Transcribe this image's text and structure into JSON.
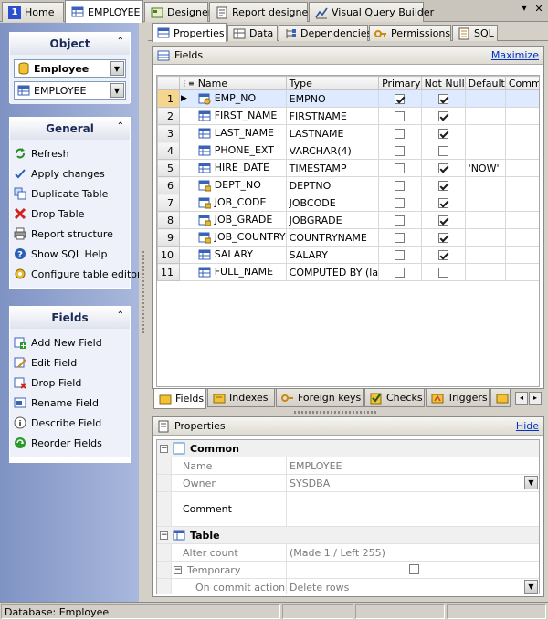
{
  "top_tabs": [
    {
      "label": "Home",
      "icon": "home-1-icon"
    },
    {
      "label": "EMPLOYEE",
      "icon": "table-icon"
    },
    {
      "label": "Designer",
      "icon": "designer-icon"
    },
    {
      "label": "Report designer",
      "icon": "report-icon"
    },
    {
      "label": "Visual Query Builder",
      "icon": "query-icon"
    }
  ],
  "home_num": "1",
  "window_controls": {
    "dropdown": "▾",
    "close": "✕"
  },
  "left": {
    "object": {
      "title": "Object",
      "database_combo": "Employee",
      "table_combo": "EMPLOYEE"
    },
    "general": {
      "title": "General",
      "items": [
        "Refresh",
        "Apply changes",
        "Duplicate Table",
        "Drop Table",
        "Report structure",
        "Show SQL Help",
        "Configure table editor"
      ]
    },
    "fields": {
      "title": "Fields",
      "items": [
        "Add New Field",
        "Edit Field",
        "Drop Field",
        "Rename Field",
        "Describe Field",
        "Reorder Fields"
      ]
    }
  },
  "sub_tabs": [
    "Properties",
    "Data",
    "Dependencies",
    "Permissions",
    "SQL"
  ],
  "fields_panel": {
    "title": "Fields",
    "maximize": "Maximize",
    "columns": [
      "Name",
      "Type",
      "Primary",
      "Not Null",
      "Default",
      "Comment"
    ],
    "rows": [
      {
        "n": "1",
        "name": "EMP_NO",
        "type": "EMPNO",
        "primary": true,
        "notnull": true,
        "default": "",
        "icon": "pk-field"
      },
      {
        "n": "2",
        "name": "FIRST_NAME",
        "type": "FIRSTNAME",
        "primary": false,
        "notnull": true,
        "default": "",
        "icon": "field"
      },
      {
        "n": "3",
        "name": "LAST_NAME",
        "type": "LASTNAME",
        "primary": false,
        "notnull": true,
        "default": "",
        "icon": "field"
      },
      {
        "n": "4",
        "name": "PHONE_EXT",
        "type": "VARCHAR(4)",
        "primary": false,
        "notnull": false,
        "default": "",
        "icon": "field"
      },
      {
        "n": "5",
        "name": "HIRE_DATE",
        "type": "TIMESTAMP",
        "primary": false,
        "notnull": true,
        "default": "'NOW'",
        "icon": "field"
      },
      {
        "n": "6",
        "name": "DEPT_NO",
        "type": "DEPTNO",
        "primary": false,
        "notnull": true,
        "default": "",
        "icon": "fk-field"
      },
      {
        "n": "7",
        "name": "JOB_CODE",
        "type": "JOBCODE",
        "primary": false,
        "notnull": true,
        "default": "",
        "icon": "fk-field"
      },
      {
        "n": "8",
        "name": "JOB_GRADE",
        "type": "JOBGRADE",
        "primary": false,
        "notnull": true,
        "default": "",
        "icon": "fk-field"
      },
      {
        "n": "9",
        "name": "JOB_COUNTRY",
        "type": "COUNTRYNAME",
        "primary": false,
        "notnull": true,
        "default": "",
        "icon": "fk-field"
      },
      {
        "n": "10",
        "name": "SALARY",
        "type": "SALARY",
        "primary": false,
        "notnull": true,
        "default": "",
        "icon": "field"
      },
      {
        "n": "11",
        "name": "FULL_NAME",
        "type": "COMPUTED BY (la",
        "primary": false,
        "notnull": false,
        "default": "",
        "icon": "field"
      }
    ]
  },
  "bottom_tabs": [
    "Fields",
    "Indexes",
    "Foreign keys",
    "Checks",
    "Triggers"
  ],
  "properties": {
    "title": "Properties",
    "hide": "Hide",
    "common": {
      "title": "Common",
      "name_label": "Name",
      "name_value": "EMPLOYEE",
      "owner_label": "Owner",
      "owner_value": "SYSDBA",
      "comment_label": "Comment"
    },
    "table": {
      "title": "Table",
      "alter_label": "Alter count",
      "alter_value": "(Made 1 / Left 255)",
      "temp_label": "Temporary",
      "commit_label": "On commit action",
      "commit_value": "Delete rows"
    }
  },
  "status": {
    "database": "Database: Employee"
  },
  "colors": {
    "accent": "#4a6ab5",
    "panel_gradient": "#8fa2cf"
  }
}
